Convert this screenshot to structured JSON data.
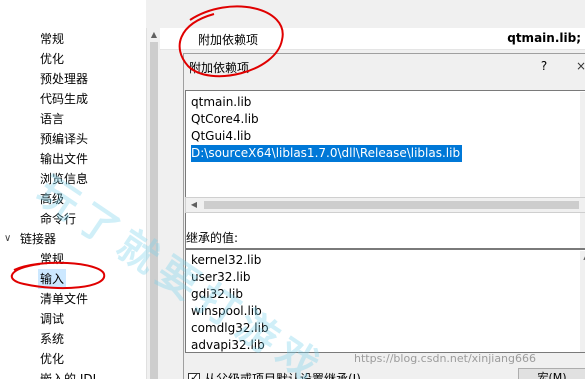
{
  "tree": {
    "items": [
      {
        "label": "常规"
      },
      {
        "label": "优化"
      },
      {
        "label": "预处理器"
      },
      {
        "label": "代码生成"
      },
      {
        "label": "语言"
      },
      {
        "label": "预编译头"
      },
      {
        "label": "输出文件"
      },
      {
        "label": "浏览信息"
      },
      {
        "label": "高级"
      },
      {
        "label": "命令行"
      }
    ],
    "linker": {
      "label": "链接器",
      "items": [
        {
          "label": "常规"
        },
        {
          "label": "输入"
        },
        {
          "label": "清单文件"
        },
        {
          "label": "调试"
        },
        {
          "label": "系统"
        },
        {
          "label": "优化"
        },
        {
          "label": "嵌入的 IDL"
        }
      ]
    }
  },
  "property": {
    "name": "附加依赖项",
    "value": "qtmain.lib;"
  },
  "dialog": {
    "title": "附加依赖项",
    "help": "?",
    "close": "×",
    "lines": [
      "qtmain.lib",
      "QtCore4.lib",
      "QtGui4.lib",
      "D:\\sourceX64\\liblas1.7.0\\dll\\Release\\liblas.lib"
    ],
    "inherited_label": "继承的值:",
    "inherited": [
      "kernel32.lib",
      "user32.lib",
      "gdi32.lib",
      "winspool.lib",
      "comdlg32.lib",
      "advapi32.lib"
    ],
    "inherit_checkbox_label": "从父级或项目默认设置继承(I)",
    "macro_button": "宏(M)"
  },
  "watermark": {
    "big": "玩了就要打游戏",
    "url": "https://blog.csdn.net/xinjiang666"
  },
  "colors": {
    "selection": "#0078d7",
    "tree_selection": "#cce8ff",
    "annotation": "#e00000",
    "watermark": "#78d2eb"
  }
}
